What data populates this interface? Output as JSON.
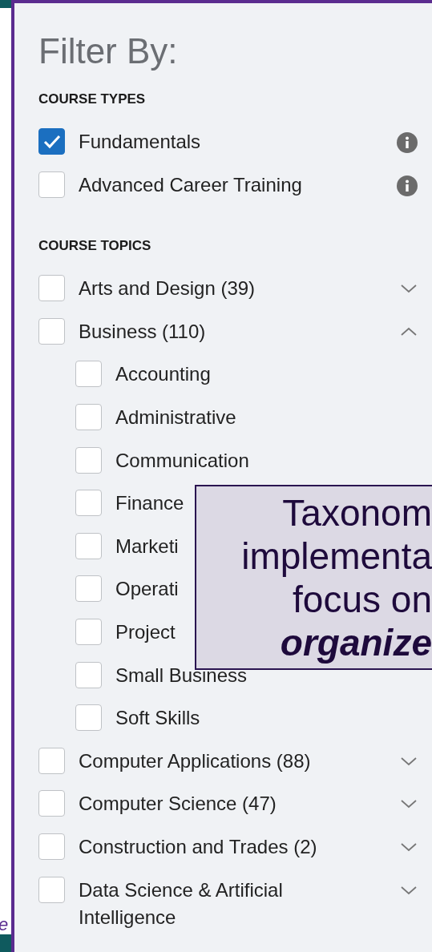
{
  "panel": {
    "title": "Filter By:",
    "course_types": {
      "heading": "COURSE TYPES",
      "items": [
        {
          "label": "Fundamentals",
          "checked": true
        },
        {
          "label": "Advanced Career Training",
          "checked": false
        }
      ]
    },
    "course_topics": {
      "heading": "COURSE TOPICS",
      "items": [
        {
          "label": "Arts and Design (39)",
          "checked": false,
          "expanded": false
        },
        {
          "label": "Business (110)",
          "checked": false,
          "expanded": true,
          "children": [
            {
              "label": "Accounting",
              "checked": false
            },
            {
              "label": "Administrative",
              "checked": false
            },
            {
              "label": "Communication",
              "checked": false
            },
            {
              "label": "Finance",
              "checked": false
            },
            {
              "label": "Marketi",
              "checked": false
            },
            {
              "label": "Operati",
              "checked": false
            },
            {
              "label": "Project",
              "checked": false
            },
            {
              "label": "Small Business",
              "checked": false
            },
            {
              "label": "Soft Skills",
              "checked": false
            }
          ]
        },
        {
          "label": "Computer Applications (88)",
          "checked": false,
          "expanded": false
        },
        {
          "label": "Computer Science (47)",
          "checked": false,
          "expanded": false
        },
        {
          "label": "Construction and Trades (2)",
          "checked": false,
          "expanded": false
        },
        {
          "label": "Data Science & Artificial Intelligence",
          "checked": false,
          "expanded": false
        }
      ]
    }
  },
  "side_caption": "e",
  "callout": {
    "lines": [
      "Taxonom",
      "implementa",
      "focus on",
      "organize"
    ]
  }
}
